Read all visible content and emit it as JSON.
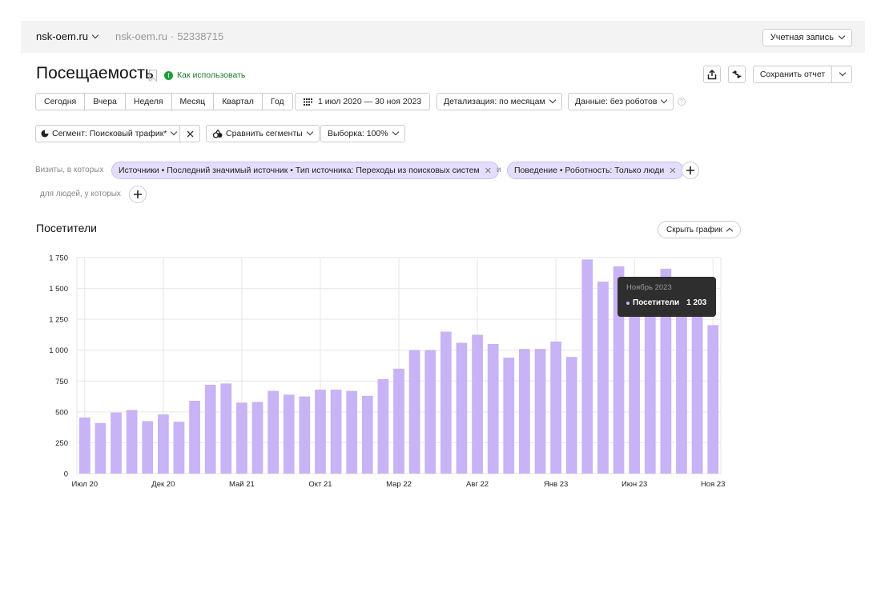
{
  "topbar": {
    "site": "nsk-oem.ru",
    "site_sub": "nsk-oem.ru",
    "separator": "·",
    "counter_id": "52338715",
    "account_label": "Учетная запись"
  },
  "header": {
    "title": "Посещаемость",
    "howto_label": "Как использовать",
    "save_report_label": "Сохранить отчет"
  },
  "periods": [
    "Сегодня",
    "Вчера",
    "Неделя",
    "Месяц",
    "Квартал",
    "Год"
  ],
  "toolbar": {
    "date_range": "1 июл 2020 — 30 ноя 2023",
    "detail": "Детализация: по месяцам",
    "data": "Данные: без роботов",
    "help": "?",
    "segment": "Сегмент: Поисковый трафик*",
    "compare": "Сравнить сегменты",
    "sample": "Выборка: 100%"
  },
  "filters": {
    "visits_label": "Визиты, в которых",
    "chip1": "Источники • Последний значимый источник • Тип источника: Переходы из поисковых систем",
    "and_label": "и",
    "chip2": "Поведение • Роботность: Только люди",
    "people_label": "для людей, у которых"
  },
  "section": {
    "title": "Посетители",
    "hide_chart": "Скрыть график"
  },
  "tooltip": {
    "month": "Ноябрь 2023",
    "series": "Посетители",
    "value": "1 203"
  },
  "chart_data": {
    "type": "bar",
    "series_name": "Посетители",
    "color": "#c7b3f5",
    "ylim": [
      0,
      1750
    ],
    "yticks": [
      0,
      250,
      500,
      750,
      1000,
      1250,
      1500,
      1750
    ],
    "ytick_labels": [
      "0",
      "250",
      "500",
      "750",
      "1 000",
      "1 250",
      "1 500",
      "1 750"
    ],
    "xtick_labels": [
      {
        "index": 0,
        "label": "Июл 20"
      },
      {
        "index": 5,
        "label": "Дек 20"
      },
      {
        "index": 10,
        "label": "Май 21"
      },
      {
        "index": 15,
        "label": "Окт 21"
      },
      {
        "index": 20,
        "label": "Мар 22"
      },
      {
        "index": 25,
        "label": "Авг 22"
      },
      {
        "index": 30,
        "label": "Янв 23"
      },
      {
        "index": 35,
        "label": "Июн 23"
      },
      {
        "index": 40,
        "label": "Ноя 23"
      }
    ],
    "values": [
      455,
      410,
      495,
      515,
      425,
      480,
      420,
      590,
      720,
      730,
      575,
      580,
      670,
      640,
      625,
      680,
      680,
      670,
      630,
      765,
      850,
      1000,
      1000,
      1150,
      1060,
      1125,
      1050,
      940,
      1010,
      1010,
      1070,
      945,
      1735,
      1555,
      1680,
      1580,
      1550,
      1660,
      1550,
      1570,
      1203
    ],
    "grid": true,
    "legend": "none"
  }
}
